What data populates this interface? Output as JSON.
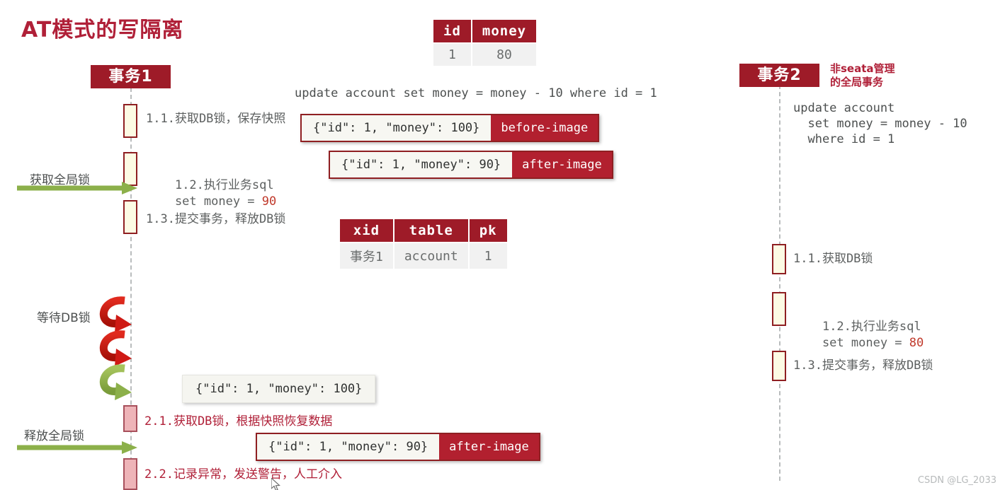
{
  "title": "AT模式的写隔离",
  "watermark": "CSDN @LG_2033",
  "colors": {
    "brand_red": "#9e1b28",
    "title_red": "#b02038",
    "activation_fill": "#fdfbe4",
    "activation_border": "#8f1f22",
    "pink_fill": "#eeb4b8",
    "pink_border": "#a8505c",
    "green_arrow": "#8cb04a",
    "red_arrow": "#cf1a15",
    "lifeline": "#b9bcbd"
  },
  "actors": {
    "tx1": {
      "label": "事务1"
    },
    "tx2": {
      "label": "事务2",
      "note": "非seata管理\n的全局事务"
    }
  },
  "account_table": {
    "headers": [
      "id",
      "money"
    ],
    "rows": [
      [
        "1",
        "80"
      ]
    ]
  },
  "lock_table": {
    "headers": [
      "xid",
      "table",
      "pk"
    ],
    "rows": [
      [
        "事务1",
        "account",
        "1"
      ]
    ]
  },
  "sql": {
    "tx1_update": "update account set money = money - 10 where id = 1",
    "tx2_update": "update account\n  set money = money - 10\n  where id = 1"
  },
  "tx1_steps": [
    {
      "text": "1.1.获取DB锁，保存快照"
    },
    {
      "text": "1.2.执行业务sql\n    set money = ",
      "value": "90"
    },
    {
      "text": "1.3.提交事务，释放DB锁"
    }
  ],
  "tx1_rollback_steps": [
    {
      "text": "2.1.获取DB锁，根据快照恢复数据"
    },
    {
      "text": "2.2.记录异常，发送警告，人工介入"
    }
  ],
  "tx2_steps": [
    {
      "text": "1.1.获取DB锁"
    },
    {
      "text": "1.2.执行业务sql\n    set money = ",
      "value": "80"
    },
    {
      "text": "1.3.提交事务，释放DB锁"
    }
  ],
  "arrows": {
    "acquire_global_lock": "获取全局锁",
    "release_global_lock": "释放全局锁",
    "wait_db_lock": "等待DB锁"
  },
  "images": {
    "before": {
      "json": "{\"id\": 1, \"money\": 100}",
      "tag": "before-image"
    },
    "after": {
      "json": "{\"id\": 1, \"money\": 90}",
      "tag": "after-image"
    },
    "restore_snapshot": {
      "json": "{\"id\": 1, \"money\": 100}"
    },
    "after_bottom": {
      "json": "{\"id\": 1, \"money\": 90}",
      "tag": "after-image"
    }
  }
}
